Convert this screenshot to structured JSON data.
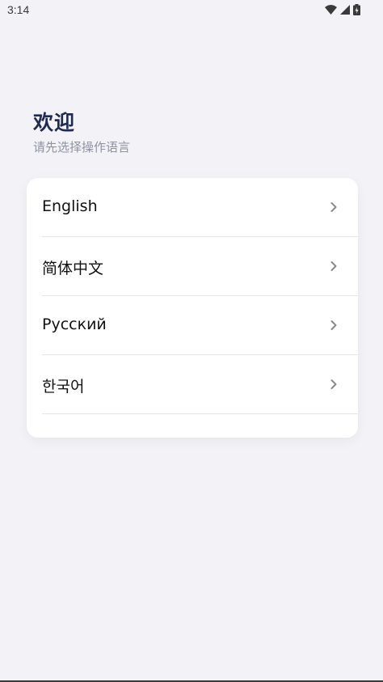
{
  "status_bar": {
    "time": "3:14",
    "icons": [
      "wifi-icon",
      "cellular-signal-icon",
      "battery-charging-icon"
    ]
  },
  "header": {
    "title": "欢迎",
    "subtitle": "请先选择操作语言"
  },
  "languages": [
    {
      "label": "English",
      "icon": "chevron-right-icon"
    },
    {
      "label": "简体中文",
      "icon": "chevron-right-icon"
    },
    {
      "label": "Русский",
      "icon": "chevron-right-icon"
    },
    {
      "label": "한국어",
      "icon": "chevron-right-icon"
    }
  ],
  "colors": {
    "background": "#f2f2f7",
    "title": "#1f2b52",
    "subtitle": "#8e93a6",
    "card": "#ffffff",
    "chevron": "#8a8a8e"
  }
}
